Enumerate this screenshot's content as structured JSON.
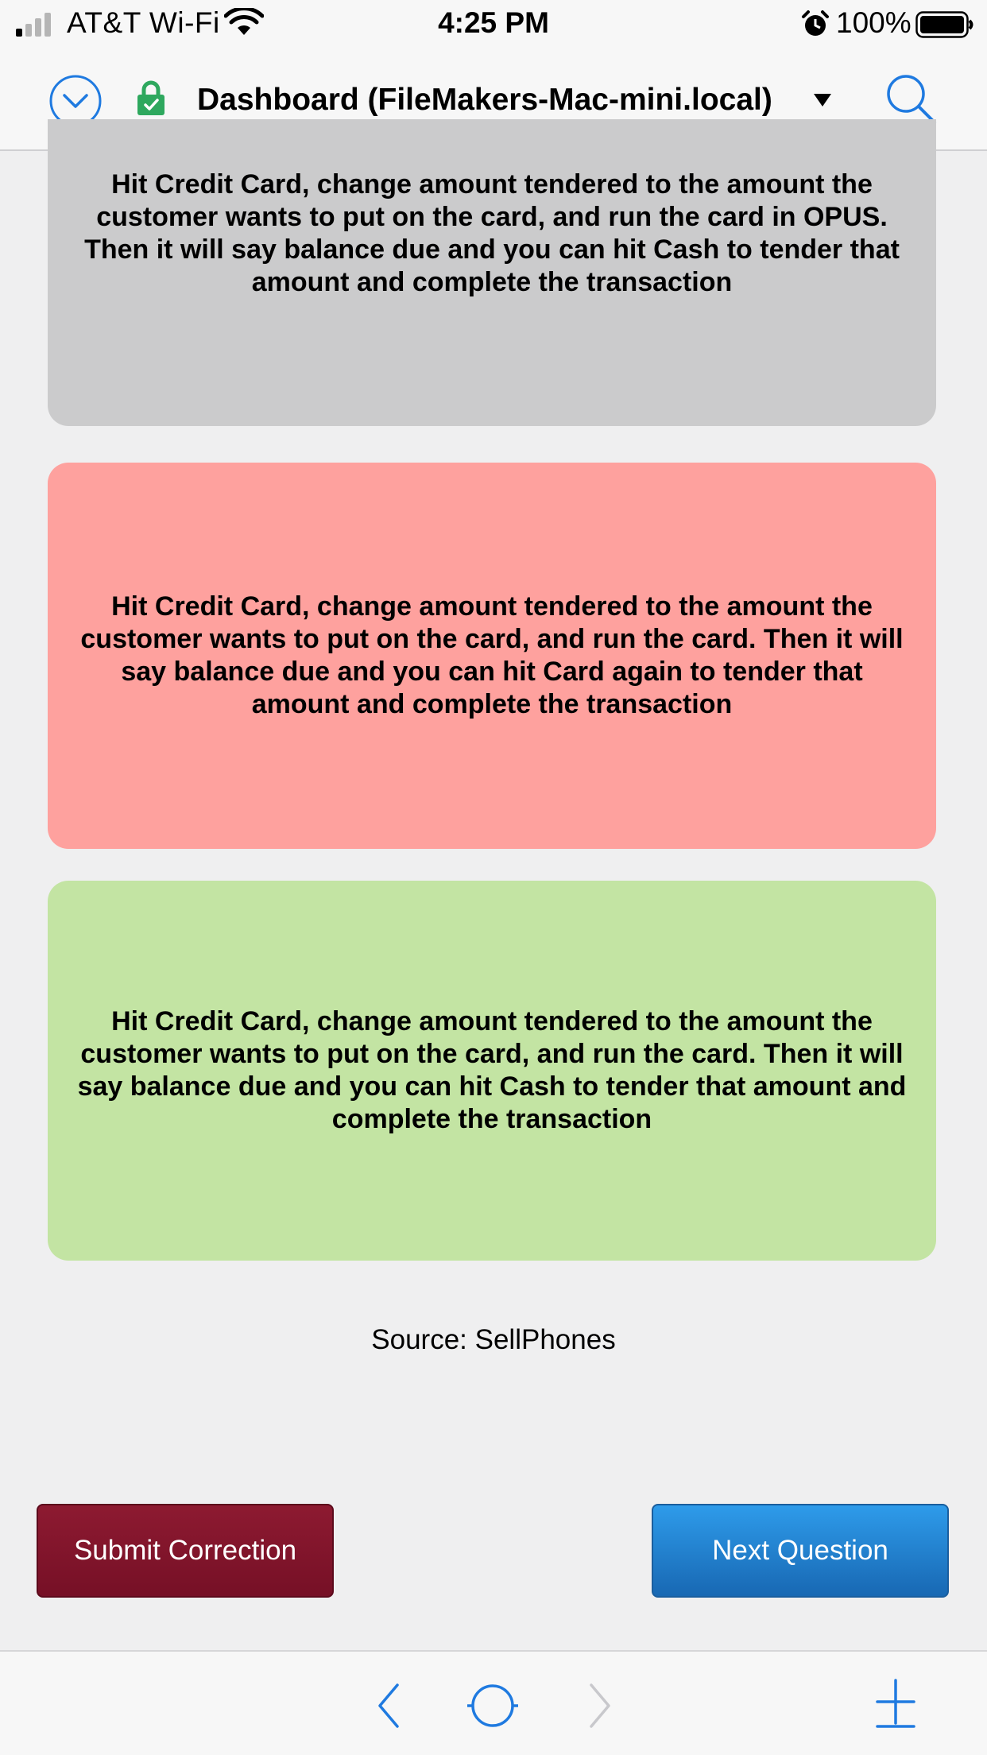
{
  "status_bar": {
    "carrier": "AT&T Wi-Fi",
    "time": "4:25 PM",
    "battery": "100%",
    "icons": [
      "signal-icon",
      "wifi-icon",
      "alarm-icon",
      "battery-icon"
    ]
  },
  "nav": {
    "title": "Dashboard (FileMakers-Mac-mini.local)",
    "icons": [
      "chevron-down-circle-icon",
      "lock-icon",
      "dropdown-triangle-icon",
      "search-icon"
    ],
    "accent_color": "#1f7ae0"
  },
  "answers": [
    {
      "text": "Hit Credit Card, change amount tendered to the amount the customer wants to put on the card, and run the card in OPUS. Then it will say balance due and you can hit Cash to tender that amount and complete the transaction",
      "color": "#cbcbcc"
    },
    {
      "text": "Hit Credit Card, change amount tendered to the amount the customer wants to put on the card, and run the card. Then it will say balance due and you can hit Card again to tender that amount and complete the transaction",
      "color": "#fea19e"
    },
    {
      "text": "Hit Credit Card, change amount tendered to the amount the customer wants to put on the card, and run the card. Then it will say balance due and you can hit Cash to tender that amount and complete the transaction",
      "color": "#c3e4a3"
    }
  ],
  "source": "Source: SellPhones",
  "buttons": {
    "submit_correction": "Submit Correction",
    "next_question": "Next Question",
    "submit_color": "#801428",
    "next_color": "#2580cf"
  },
  "toolbar": {
    "icons": [
      "back-arrow-icon",
      "home-circle-icon",
      "forward-arrow-icon",
      "add-icon"
    ]
  }
}
